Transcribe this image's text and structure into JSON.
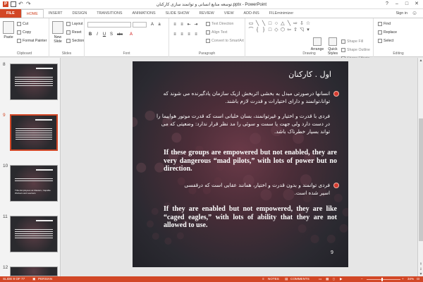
{
  "window": {
    "title": "توسعه منابع انسانی و توانمند سازی کارکنان.pptx - PowerPoint",
    "app_badge": "P",
    "help": "?",
    "minimize": "–",
    "maximize": "□",
    "close": "✕"
  },
  "tabs": [
    "FILE",
    "HOME",
    "INSERT",
    "DESIGN",
    "TRANSITIONS",
    "ANIMATIONS",
    "SLIDE SHOW",
    "REVIEW",
    "VIEW",
    "ADD-INS",
    "FILEminimizer"
  ],
  "active_tab": "HOME",
  "account": {
    "signin": "Sign in"
  },
  "ribbon": {
    "clipboard": {
      "label": "Clipboard",
      "paste": "Paste",
      "cut": "Cut",
      "copy": "Copy",
      "format_painter": "Format Painter"
    },
    "slides": {
      "label": "Slides",
      "new_slide": "New Slide",
      "layout": "Layout",
      "reset": "Reset",
      "section": "Section"
    },
    "font": {
      "label": "Font",
      "bold": "B",
      "italic": "I",
      "underline": "U",
      "shadow": "S",
      "strike": "abc"
    },
    "paragraph": {
      "label": "Paragraph",
      "text_direction": "Text Direction",
      "align_text": "Align Text",
      "convert_smartart": "Convert to SmartArt"
    },
    "drawing": {
      "label": "Drawing",
      "arrange": "Arrange",
      "quick_styles": "Quick Styles",
      "shape_fill": "Shape Fill",
      "shape_outline": "Shape Outline",
      "shape_effects": "Shape Effects"
    },
    "editing": {
      "label": "Editing",
      "find": "Find",
      "replace": "Replace",
      "select": "Select"
    }
  },
  "thumbnails": [
    {
      "num": "8",
      "text": ""
    },
    {
      "num": "9",
      "text": ""
    },
    {
      "num": "10",
      "text": "Tribe Employees as Masters, Capable Workers and Learners"
    },
    {
      "num": "11",
      "text": ""
    },
    {
      "num": "12",
      "text": ""
    }
  ],
  "slide": {
    "title": "اول . کارکنان",
    "fa1": "انسانها درصورتی مبدل به بخشی اثربخش ازیک سازمان یادگیرنده می شوند که توانا،توانمند و دارای اختیارات و قدرت لازم باشند.",
    "fa2": "فردی با قدرت و اختیار و غیرتوانمند، بسان خلبانی است که قدرت موتور هواپیما را در دست دارد ولی جهت یا سمت و سوئی را مد نظر قرار ندارد: وضعیتی که می تواند بسیار خطرناک باشد.",
    "en1": "If these groups are empowered but not enabled, they are very dangerous “mad pilots,” with lots of power but no direction.",
    "fa3": "فردی توانمند و بدون قدرت و اختیار، همانند عقابی است که درقفسی اسیر شده است.",
    "en2": "If they are enabled but not empowered, they are like “caged eagles,” with lots of ability that they are not allowed to use.",
    "page": "9"
  },
  "status": {
    "slide_of": "SLIDE 9 OF 77",
    "language": "PERSIAN",
    "notes": "NOTES",
    "comments": "COMMENTS",
    "zoom": "34%"
  },
  "colors": {
    "accent": "#d24726",
    "bullet": "#d43a2f"
  }
}
